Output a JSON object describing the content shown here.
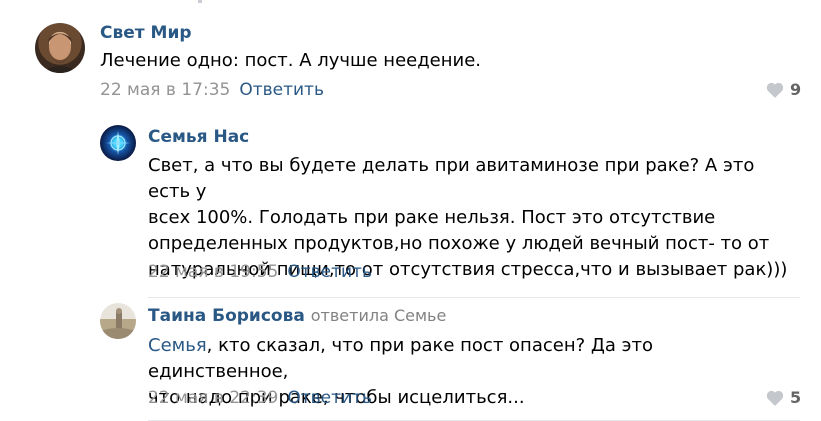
{
  "comments": [
    {
      "author": "Свет Мир",
      "text": "Лечение одно: пост. А лучше неедение.",
      "date": "22 мая в 17:35",
      "reply_label": "Ответить",
      "likes": "9"
    },
    {
      "author": "Семья Нас",
      "text_lines": [
        "Свет, а что вы будете делать при авитаминозе при раке? А это есть у",
        "всех 100%. Голодать при раке нельзя. Пост это отсутствие",
        "определенных продуктов,но похоже у людей вечный пост- то от",
        "натуральной пищи,то от отсутствия стресса,что и вызывает рак)))"
      ],
      "date": "22 мая в 19:55",
      "reply_label": "Ответить"
    },
    {
      "author": "Таина Борисова",
      "author_meta": "ответила Семье",
      "mention": "Семья",
      "text_line1_rest": ", кто сказал, что при раке пост опасен? Да это единственное,",
      "text_line2": "что надо при раке, чтобы исцелиться...",
      "date": "22 мая в 22:39",
      "reply_label": "Ответить",
      "likes": "5"
    }
  ],
  "icons": {
    "like": "heart-icon"
  },
  "colors": {
    "link": "#2a5885",
    "meta": "#939393",
    "like": "#c4c8cc"
  }
}
